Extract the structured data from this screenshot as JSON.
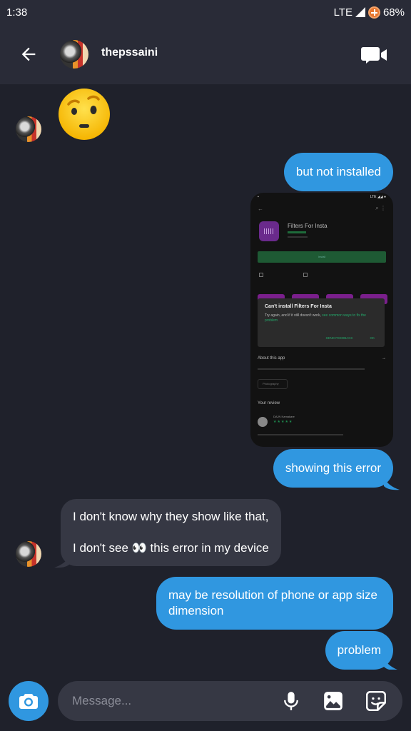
{
  "status_bar": {
    "time": "1:38",
    "network": "LTE",
    "battery": "68%"
  },
  "header": {
    "contact_name": "thepssaini",
    "icons": {
      "back": "arrow-left-icon",
      "video": "video-camera-icon"
    }
  },
  "messages": [
    {
      "direction": "incoming",
      "type": "emoji",
      "content": "🤨",
      "emoji_name": "face-with-raised-eyebrow"
    },
    {
      "direction": "outgoing",
      "type": "text",
      "text": "but not installed"
    },
    {
      "direction": "outgoing",
      "type": "image",
      "image": {
        "app_title": "Filters For Insta",
        "install_label": "Install",
        "dialog_title": "Can't install Filters For Insta",
        "dialog_body": "Try again, and if it still doesn't work,",
        "dialog_link": "see common ways to fix the problem",
        "dialog_actions": [
          "SEND FEEDBACK",
          "OK"
        ],
        "about_label": "About this app",
        "chip_label": "Photography",
        "review_label": "Your review",
        "reviewer_name": "DAJN Kamakare",
        "review_stars": "★★★★★"
      }
    },
    {
      "direction": "outgoing",
      "type": "text",
      "text": "showing this error"
    },
    {
      "direction": "incoming",
      "type": "text",
      "line1": "I don't know why they show like that,",
      "line2": "I don't see 👀 this error in my device"
    },
    {
      "direction": "outgoing",
      "type": "text",
      "line1": "may be resolution of phone or app size",
      "line2": "dimension"
    },
    {
      "direction": "outgoing",
      "type": "text",
      "text": "problem"
    }
  ],
  "composer": {
    "placeholder": "Message...",
    "icons": [
      "camera-icon",
      "microphone-icon",
      "gallery-icon",
      "sticker-icon"
    ]
  },
  "colors": {
    "background": "#1f212b",
    "header": "#292b37",
    "outgoing_bubble": "#3097e0",
    "incoming_bubble": "#363844"
  }
}
